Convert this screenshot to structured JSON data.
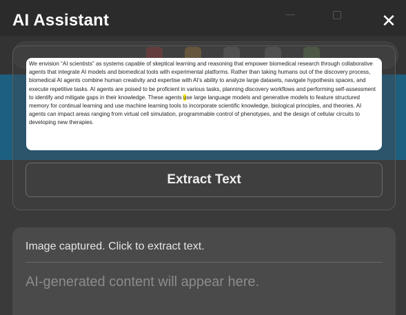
{
  "panel": {
    "title": "AI Assistant",
    "close_glyph": "✕",
    "close_icon": "close-icon"
  },
  "capture": {
    "text_before_highlight": "We envision “AI scientists” as systems capable of skeptical learning and reasoning that empower biomedical research through collaborative agents that integrate AI models and biomedical tools with experimental platforms. Rather than taking humans out of the discovery process, biomedical AI agents combine human creativity and expertise with AI’s ability to analyze large datasets, navigate hypothesis spaces, and execute repetitive tasks. AI agents are poised to be proficient in various tasks, planning discovery workflows and performing self-assessment to identify and mitigate gaps in their knowledge. These agents ",
    "highlight": "u",
    "text_after_highlight": "se large language models and generative models to feature structured memory for continual learning and use machine learning tools to incorporate scientific knowledge, biological principles, and theories. AI agents can impact areas ranging from virtual cell simulation, programmable control of phenotypes, and the design of cellular circuits to developing new therapies.",
    "extract_button_label": "Extract Text"
  },
  "output": {
    "status": "Image captured. Click to extract text.",
    "placeholder": "AI-generated content will appear here."
  },
  "colors": {
    "panel_bg": "#3a3a3a",
    "card_bg": "#4a4a4a",
    "highlight": "#f4e500",
    "underlay_blue": "#1d5f80"
  }
}
